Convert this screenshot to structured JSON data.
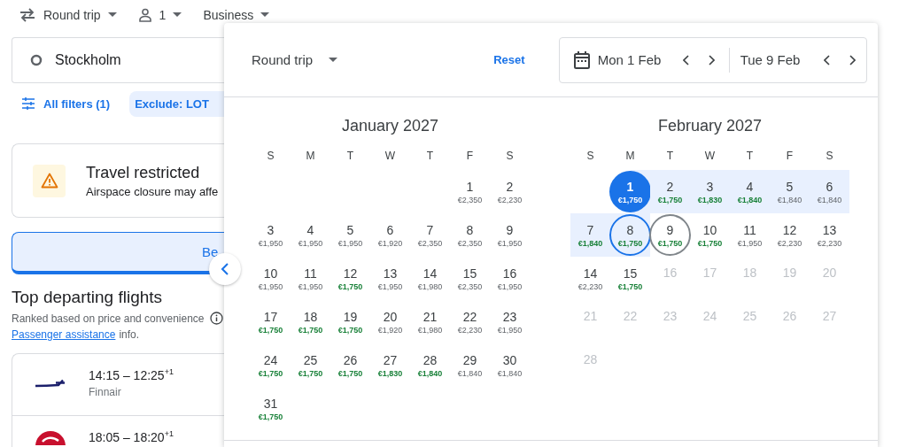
{
  "top_bar": {
    "trip_type": "Round trip",
    "passengers": "1",
    "cabin": "Business"
  },
  "origin": {
    "value": "Stockholm"
  },
  "filters": {
    "all_filters": "All filters (1)",
    "chips": [
      {
        "label": "Exclude: LOT"
      }
    ]
  },
  "alert": {
    "title": "Travel restricted",
    "text": "Airspace closure may affe"
  },
  "banner_button": {
    "label": "Be"
  },
  "section": {
    "title": "Top departing flights",
    "subtitle": "Ranked based on price and convenience",
    "link": "Passenger assistance",
    "link_suffix": "info."
  },
  "flights": [
    {
      "times": "14:15 – 12:25",
      "day_offset": "+1",
      "airline": "Finnair",
      "kind": "finnair"
    },
    {
      "times": "18:05 – 18:20",
      "day_offset": "+1",
      "kind": "turkish"
    }
  ],
  "date_picker": {
    "trip_type": "Round trip",
    "reset": "Reset",
    "departure": "Mon 1 Feb",
    "return": "Tue 9 Feb",
    "months": [
      {
        "title": "January 2027",
        "weekdays": [
          "S",
          "M",
          "T",
          "W",
          "T",
          "F",
          "S"
        ],
        "days": [
          {
            "kind": "blank"
          },
          {
            "kind": "blank"
          },
          {
            "kind": "blank"
          },
          {
            "kind": "blank"
          },
          {
            "kind": "blank"
          },
          {
            "kind": "day",
            "day": "1",
            "price": "€2,350",
            "cheap": false,
            "disabled": false,
            "selected": false,
            "in_range": false,
            "focused": false,
            "hovered": false
          },
          {
            "kind": "day",
            "day": "2",
            "price": "€2,230",
            "cheap": false,
            "disabled": false,
            "selected": false,
            "in_range": false,
            "focused": false,
            "hovered": false
          },
          {
            "kind": "day",
            "day": "3",
            "price": "€1,950",
            "cheap": false,
            "disabled": false,
            "selected": false,
            "in_range": false,
            "focused": false,
            "hovered": false
          },
          {
            "kind": "day",
            "day": "4",
            "price": "€1,950",
            "cheap": false,
            "disabled": false,
            "selected": false,
            "in_range": false,
            "focused": false,
            "hovered": false
          },
          {
            "kind": "day",
            "day": "5",
            "price": "€1,950",
            "cheap": false,
            "disabled": false,
            "selected": false,
            "in_range": false,
            "focused": false,
            "hovered": false
          },
          {
            "kind": "day",
            "day": "6",
            "price": "€1,920",
            "cheap": false,
            "disabled": false,
            "selected": false,
            "in_range": false,
            "focused": false,
            "hovered": false
          },
          {
            "kind": "day",
            "day": "7",
            "price": "€2,350",
            "cheap": false,
            "disabled": false,
            "selected": false,
            "in_range": false,
            "focused": false,
            "hovered": false
          },
          {
            "kind": "day",
            "day": "8",
            "price": "€2,350",
            "cheap": false,
            "disabled": false,
            "selected": false,
            "in_range": false,
            "focused": false,
            "hovered": false
          },
          {
            "kind": "day",
            "day": "9",
            "price": "€1,950",
            "cheap": false,
            "disabled": false,
            "selected": false,
            "in_range": false,
            "focused": false,
            "hovered": false
          },
          {
            "kind": "day",
            "day": "10",
            "price": "€1,950",
            "cheap": false,
            "disabled": false,
            "selected": false,
            "in_range": false,
            "focused": false,
            "hovered": false
          },
          {
            "kind": "day",
            "day": "11",
            "price": "€1,950",
            "cheap": false,
            "disabled": false,
            "selected": false,
            "in_range": false,
            "focused": false,
            "hovered": false
          },
          {
            "kind": "day",
            "day": "12",
            "price": "€1,750",
            "cheap": true,
            "disabled": false,
            "selected": false,
            "in_range": false,
            "focused": false,
            "hovered": false
          },
          {
            "kind": "day",
            "day": "13",
            "price": "€1,950",
            "cheap": false,
            "disabled": false,
            "selected": false,
            "in_range": false,
            "focused": false,
            "hovered": false
          },
          {
            "kind": "day",
            "day": "14",
            "price": "€1,980",
            "cheap": false,
            "disabled": false,
            "selected": false,
            "in_range": false,
            "focused": false,
            "hovered": false
          },
          {
            "kind": "day",
            "day": "15",
            "price": "€2,350",
            "cheap": false,
            "disabled": false,
            "selected": false,
            "in_range": false,
            "focused": false,
            "hovered": false
          },
          {
            "kind": "day",
            "day": "16",
            "price": "€1,950",
            "cheap": false,
            "disabled": false,
            "selected": false,
            "in_range": false,
            "focused": false,
            "hovered": false
          },
          {
            "kind": "day",
            "day": "17",
            "price": "€1,750",
            "cheap": true,
            "disabled": false,
            "selected": false,
            "in_range": false,
            "focused": false,
            "hovered": false
          },
          {
            "kind": "day",
            "day": "18",
            "price": "€1,750",
            "cheap": true,
            "disabled": false,
            "selected": false,
            "in_range": false,
            "focused": false,
            "hovered": false
          },
          {
            "kind": "day",
            "day": "19",
            "price": "€1,750",
            "cheap": true,
            "disabled": false,
            "selected": false,
            "in_range": false,
            "focused": false,
            "hovered": false
          },
          {
            "kind": "day",
            "day": "20",
            "price": "€1,920",
            "cheap": false,
            "disabled": false,
            "selected": false,
            "in_range": false,
            "focused": false,
            "hovered": false
          },
          {
            "kind": "day",
            "day": "21",
            "price": "€1,980",
            "cheap": false,
            "disabled": false,
            "selected": false,
            "in_range": false,
            "focused": false,
            "hovered": false
          },
          {
            "kind": "day",
            "day": "22",
            "price": "€2,230",
            "cheap": false,
            "disabled": false,
            "selected": false,
            "in_range": false,
            "focused": false,
            "hovered": false
          },
          {
            "kind": "day",
            "day": "23",
            "price": "€1,950",
            "cheap": false,
            "disabled": false,
            "selected": false,
            "in_range": false,
            "focused": false,
            "hovered": false
          },
          {
            "kind": "day",
            "day": "24",
            "price": "€1,750",
            "cheap": true,
            "disabled": false,
            "selected": false,
            "in_range": false,
            "focused": false,
            "hovered": false
          },
          {
            "kind": "day",
            "day": "25",
            "price": "€1,750",
            "cheap": true,
            "disabled": false,
            "selected": false,
            "in_range": false,
            "focused": false,
            "hovered": false
          },
          {
            "kind": "day",
            "day": "26",
            "price": "€1,750",
            "cheap": true,
            "disabled": false,
            "selected": false,
            "in_range": false,
            "focused": false,
            "hovered": false
          },
          {
            "kind": "day",
            "day": "27",
            "price": "€1,830",
            "cheap": true,
            "disabled": false,
            "selected": false,
            "in_range": false,
            "focused": false,
            "hovered": false
          },
          {
            "kind": "day",
            "day": "28",
            "price": "€1,840",
            "cheap": true,
            "disabled": false,
            "selected": false,
            "in_range": false,
            "focused": false,
            "hovered": false
          },
          {
            "kind": "day",
            "day": "29",
            "price": "€1,840",
            "cheap": false,
            "disabled": false,
            "selected": false,
            "in_range": false,
            "focused": false,
            "hovered": false
          },
          {
            "kind": "day",
            "day": "30",
            "price": "€1,840",
            "cheap": false,
            "disabled": false,
            "selected": false,
            "in_range": false,
            "focused": false,
            "hovered": false
          },
          {
            "kind": "day",
            "day": "31",
            "price": "€1,750",
            "cheap": true,
            "disabled": false,
            "selected": false,
            "in_range": false,
            "focused": false,
            "hovered": false
          }
        ]
      },
      {
        "title": "February 2027",
        "weekdays": [
          "S",
          "M",
          "T",
          "W",
          "T",
          "F",
          "S"
        ],
        "days": [
          {
            "kind": "blank"
          },
          {
            "kind": "day",
            "day": "1",
            "price": "€1,750",
            "cheap": true,
            "disabled": false,
            "selected": true,
            "in_range": true,
            "focused": false,
            "hovered": false
          },
          {
            "kind": "day",
            "day": "2",
            "price": "€1,750",
            "cheap": true,
            "disabled": false,
            "selected": false,
            "in_range": true,
            "focused": false,
            "hovered": false
          },
          {
            "kind": "day",
            "day": "3",
            "price": "€1,830",
            "cheap": true,
            "disabled": false,
            "selected": false,
            "in_range": true,
            "focused": false,
            "hovered": false
          },
          {
            "kind": "day",
            "day": "4",
            "price": "€1,840",
            "cheap": true,
            "disabled": false,
            "selected": false,
            "in_range": true,
            "focused": false,
            "hovered": false
          },
          {
            "kind": "day",
            "day": "5",
            "price": "€1,840",
            "cheap": false,
            "disabled": false,
            "selected": false,
            "in_range": true,
            "focused": false,
            "hovered": false
          },
          {
            "kind": "day",
            "day": "6",
            "price": "€1,840",
            "cheap": false,
            "disabled": false,
            "selected": false,
            "in_range": true,
            "focused": false,
            "hovered": false
          },
          {
            "kind": "day",
            "day": "7",
            "price": "€1,840",
            "cheap": true,
            "disabled": false,
            "selected": false,
            "in_range": true,
            "focused": false,
            "hovered": false
          },
          {
            "kind": "day",
            "day": "8",
            "price": "€1,750",
            "cheap": true,
            "disabled": false,
            "selected": false,
            "in_range": true,
            "focused": true,
            "hovered": false
          },
          {
            "kind": "day",
            "day": "9",
            "price": "€1,750",
            "cheap": true,
            "disabled": false,
            "selected": false,
            "in_range": false,
            "focused": false,
            "hovered": true
          },
          {
            "kind": "day",
            "day": "10",
            "price": "€1,750",
            "cheap": true,
            "disabled": false,
            "selected": false,
            "in_range": false,
            "focused": false,
            "hovered": false
          },
          {
            "kind": "day",
            "day": "11",
            "price": "€1,950",
            "cheap": false,
            "disabled": false,
            "selected": false,
            "in_range": false,
            "focused": false,
            "hovered": false
          },
          {
            "kind": "day",
            "day": "12",
            "price": "€2,230",
            "cheap": false,
            "disabled": false,
            "selected": false,
            "in_range": false,
            "focused": false,
            "hovered": false
          },
          {
            "kind": "day",
            "day": "13",
            "price": "€2,230",
            "cheap": false,
            "disabled": false,
            "selected": false,
            "in_range": false,
            "focused": false,
            "hovered": false
          },
          {
            "kind": "day",
            "day": "14",
            "price": "€2,230",
            "cheap": false,
            "disabled": false,
            "selected": false,
            "in_range": false,
            "focused": false,
            "hovered": false
          },
          {
            "kind": "day",
            "day": "15",
            "price": "€1,750",
            "cheap": true,
            "disabled": false,
            "selected": false,
            "in_range": false,
            "focused": false,
            "hovered": false
          },
          {
            "kind": "day",
            "day": "16",
            "disabled": true,
            "selected": false,
            "in_range": false,
            "focused": false,
            "hovered": false
          },
          {
            "kind": "day",
            "day": "17",
            "disabled": true,
            "selected": false,
            "in_range": false,
            "focused": false,
            "hovered": false
          },
          {
            "kind": "day",
            "day": "18",
            "disabled": true,
            "selected": false,
            "in_range": false,
            "focused": false,
            "hovered": false
          },
          {
            "kind": "day",
            "day": "19",
            "disabled": true,
            "selected": false,
            "in_range": false,
            "focused": false,
            "hovered": false
          },
          {
            "kind": "day",
            "day": "20",
            "disabled": true,
            "selected": false,
            "in_range": false,
            "focused": false,
            "hovered": false
          },
          {
            "kind": "day",
            "day": "21",
            "disabled": true,
            "selected": false,
            "in_range": false,
            "focused": false,
            "hovered": false
          },
          {
            "kind": "day",
            "day": "22",
            "disabled": true,
            "selected": false,
            "in_range": false,
            "focused": false,
            "hovered": false
          },
          {
            "kind": "day",
            "day": "23",
            "disabled": true,
            "selected": false,
            "in_range": false,
            "focused": false,
            "hovered": false
          },
          {
            "kind": "day",
            "day": "24",
            "disabled": true,
            "selected": false,
            "in_range": false,
            "focused": false,
            "hovered": false
          },
          {
            "kind": "day",
            "day": "25",
            "disabled": true,
            "selected": false,
            "in_range": false,
            "focused": false,
            "hovered": false
          },
          {
            "kind": "day",
            "day": "26",
            "disabled": true,
            "selected": false,
            "in_range": false,
            "focused": false,
            "hovered": false
          },
          {
            "kind": "day",
            "day": "27",
            "disabled": true,
            "selected": false,
            "in_range": false,
            "focused": false,
            "hovered": false
          },
          {
            "kind": "day",
            "day": "28",
            "disabled": true,
            "selected": false,
            "in_range": false,
            "focused": false,
            "hovered": false
          }
        ]
      }
    ]
  }
}
